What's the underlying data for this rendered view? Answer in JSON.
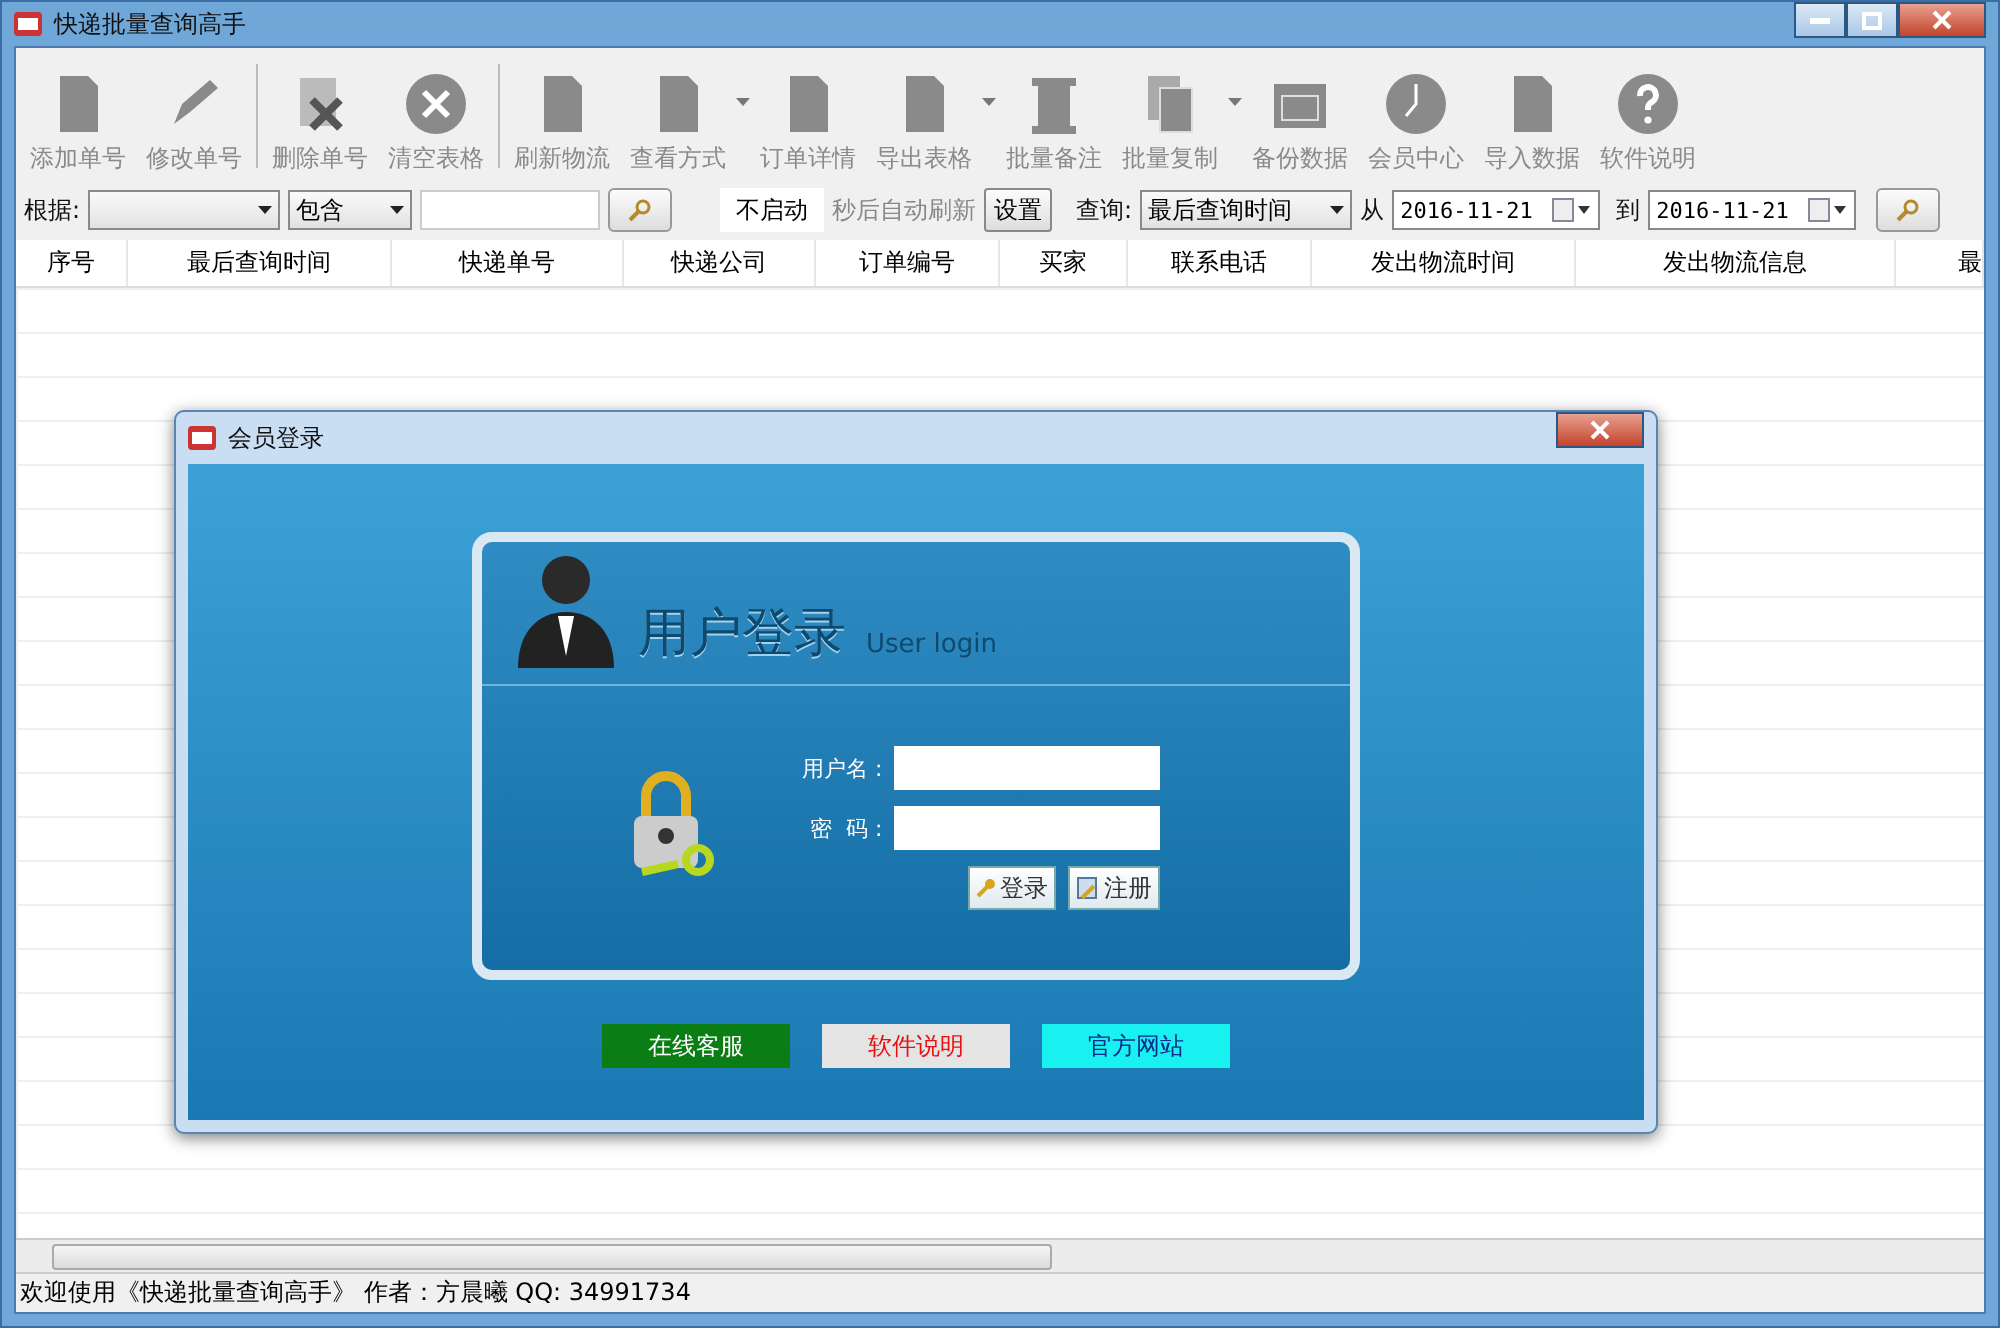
{
  "window": {
    "title": "快递批量查询高手"
  },
  "toolbar": [
    {
      "label": "添加单号",
      "disabled": true,
      "has_menu": false
    },
    {
      "label": "修改单号",
      "disabled": true,
      "has_menu": false
    },
    {
      "label": "删除单号",
      "disabled": true,
      "has_menu": false
    },
    {
      "label": "清空表格",
      "disabled": true,
      "has_menu": false
    },
    {
      "label": "刷新物流",
      "disabled": true,
      "has_menu": false
    },
    {
      "label": "查看方式",
      "disabled": true,
      "has_menu": true
    },
    {
      "label": "订单详情",
      "disabled": true,
      "has_menu": false
    },
    {
      "label": "导出表格",
      "disabled": true,
      "has_menu": true
    },
    {
      "label": "批量备注",
      "disabled": true,
      "has_menu": false
    },
    {
      "label": "批量复制",
      "disabled": true,
      "has_menu": true
    },
    {
      "label": "备份数据",
      "disabled": true,
      "has_menu": false
    },
    {
      "label": "会员中心",
      "disabled": true,
      "has_menu": false
    },
    {
      "label": "导入数据",
      "disabled": true,
      "has_menu": false
    },
    {
      "label": "软件说明",
      "disabled": true,
      "has_menu": false
    }
  ],
  "filter": {
    "basis_label": "根据:",
    "match_value": "包含",
    "refresh_value": "不启动",
    "refresh_label": "秒后自动刷新",
    "settings_button": "设置",
    "query_label": "查询:",
    "query_value": "最后查询时间",
    "from_label": "从",
    "from_date": "2016-11-21",
    "to_label": "到",
    "to_date": "2016-11-21"
  },
  "table": {
    "columns": [
      "序号",
      "最后查询时间",
      "快递单号",
      "快递公司",
      "订单编号",
      "买家",
      "联系电话",
      "发出物流时间",
      "发出物流信息",
      "最"
    ]
  },
  "status_bar": "欢迎使用《快递批量查询高手》 作者：方晨曦  QQ: 34991734",
  "dialog": {
    "title": "会员登录",
    "heading": "用户登录",
    "subheading": "User login",
    "username_label": "用户名 :",
    "password_label": "密  码 :",
    "login_button": "登录",
    "register_button": "注册",
    "links": [
      {
        "label": "在线客服",
        "color": "#0a7d14"
      },
      {
        "label": "软件说明",
        "color": "#e4e4e4"
      },
      {
        "label": "官方网站",
        "color": "#19f0f0"
      }
    ]
  }
}
